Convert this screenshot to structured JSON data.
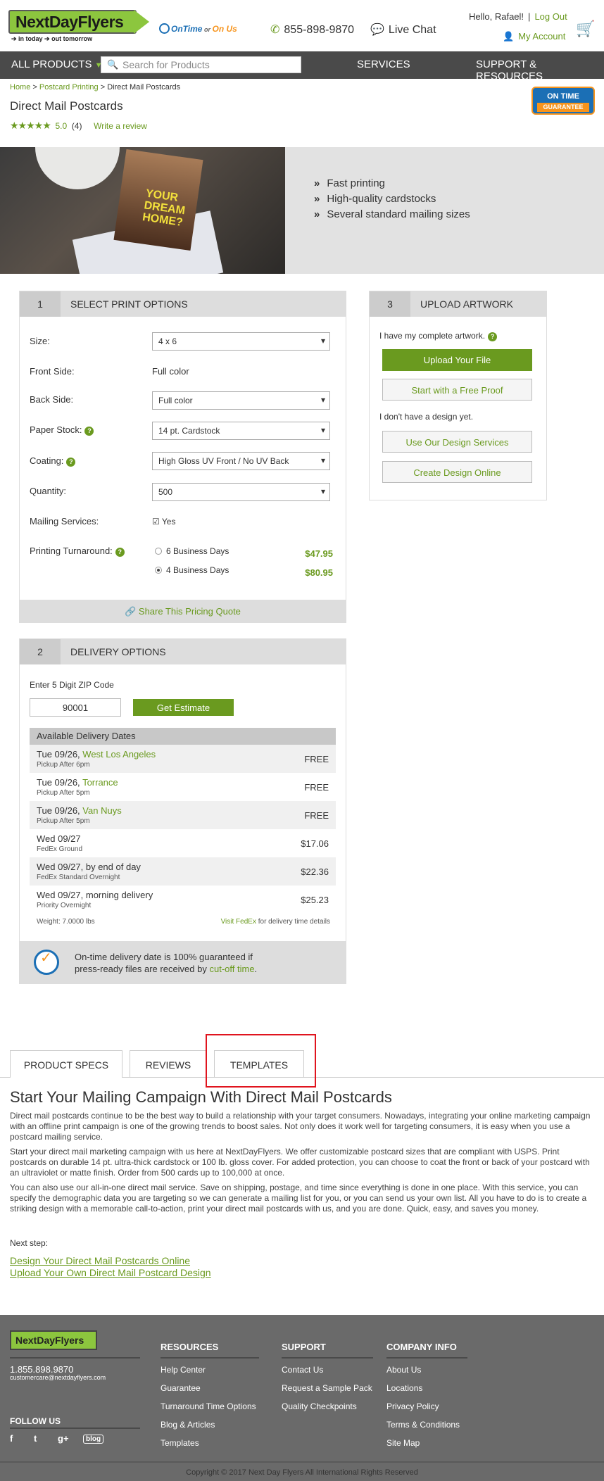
{
  "header": {
    "logo": "NextDayFlyers",
    "tagline": "➔ in today ➔ out tomorrow",
    "ontime": "OnTime",
    "ontime_or": " or ",
    "ontime_us": "On Us",
    "phone": "855-898-9870",
    "live_chat": "Live Chat",
    "greeting": "Hello, Rafael!",
    "logout": "Log Out",
    "my_account": "My Account"
  },
  "nav": {
    "all_products": "ALL PRODUCTS",
    "search_placeholder": "Search for Products",
    "services": "SERVICES",
    "support": "SUPPORT & RESOURCES"
  },
  "breadcrumb": {
    "home": "Home",
    "sep": " > ",
    "printing": "Postcard Printing",
    "current": "Direct Mail Postcards"
  },
  "product": {
    "title": "Direct Mail Postcards",
    "stars": "★★★★★",
    "rating": "5.0",
    "count": "(4)",
    "write_review": "Write a review",
    "badge_top": "ON TIME",
    "badge_bottom": "GUARANTEE",
    "hero_card_text": "YOUR DREAM HOME?",
    "bullets": [
      "Fast printing",
      "High-quality cardstocks",
      "Several standard mailing sizes"
    ]
  },
  "print_options": {
    "num": "1",
    "title": "SELECT PRINT OPTIONS",
    "size_label": "Size:",
    "size": "4 x 6",
    "front_label": "Front Side:",
    "front": "Full color",
    "back_label": "Back Side:",
    "back": "Full color",
    "paper_label": "Paper Stock:",
    "paper": "14 pt. Cardstock",
    "coating_label": "Coating:",
    "coating": "High Gloss UV Front / No UV Back",
    "qty_label": "Quantity:",
    "qty": "500",
    "mailing_label": "Mailing Services:",
    "mailing": "Yes",
    "turn_label": "Printing Turnaround:",
    "turn1": "6 Business Days",
    "turn1_price": "$47.95",
    "turn2": "4 Business Days",
    "turn2_price": "$80.95",
    "share": "Share This Pricing Quote"
  },
  "upload": {
    "num": "3",
    "title": "UPLOAD ARTWORK",
    "have_artwork": "I have my complete artwork.",
    "upload_btn": "Upload Your File",
    "proof_btn": "Start with a Free Proof",
    "no_design": "I don't have a design yet.",
    "design_services": "Use Our Design Services",
    "design_online": "Create Design Online"
  },
  "delivery": {
    "num": "2",
    "title": "DELIVERY OPTIONS",
    "zip_label": "Enter 5 Digit ZIP Code",
    "zip": "90001",
    "estimate": "Get Estimate",
    "table_header": "Available Delivery Dates",
    "rows": [
      {
        "date": "Tue 09/26, ",
        "place": "West Los Angeles",
        "sub": "Pickup After 6pm",
        "price": "FREE"
      },
      {
        "date": "Tue 09/26, ",
        "place": "Torrance",
        "sub": "Pickup After 5pm",
        "price": "FREE"
      },
      {
        "date": "Tue 09/26, ",
        "place": "Van Nuys",
        "sub": "Pickup After 5pm",
        "price": "FREE"
      },
      {
        "date": "Wed 09/27",
        "place": "",
        "sub": "FedEx Ground",
        "price": "$17.06"
      },
      {
        "date": "Wed 09/27, by end of day",
        "place": "",
        "sub": "FedEx Standard Overnight",
        "price": "$22.36"
      },
      {
        "date": "Wed 09/27, morning delivery",
        "place": "",
        "sub": "Priority Overnight",
        "price": "$25.23"
      }
    ],
    "weight": "Weight: 7.0000 lbs",
    "visit_fedex": "Visit FedEx",
    "visit_rest": " for delivery time details",
    "guarantee_1": "On-time delivery date is 100% guaranteed if",
    "guarantee_2": "press-ready files are received by ",
    "cutoff": "cut-off time",
    "dot": "."
  },
  "tabs": [
    "PRODUCT SPECS",
    "REVIEWS",
    "TEMPLATES"
  ],
  "content": {
    "heading": "Start Your Mailing Campaign With Direct Mail Postcards",
    "p1": "Direct mail postcards continue to be the best way to build a relationship with your target consumers. Nowadays, integrating your online marketing campaign with an offline print campaign is one of the growing trends to boost sales. Not only does it work well for targeting consumers, it is easy when you use a postcard mailing service.",
    "p2": "Start your direct mail marketing campaign with us here at NextDayFlyers. We offer customizable postcard sizes that are compliant with USPS. Print postcards on durable 14 pt. ultra-thick cardstock or 100 lb. gloss cover. For added protection, you can choose to coat the front or back of your postcard with an ultraviolet or matte finish. Order from 500 cards up to 100,000 at once.",
    "p3": "You can also use our all-in-one direct mail service. Save on shipping, postage, and time since everything is done in one place. With this service, you can specify the demographic data you are targeting so we can generate a mailing list for you, or you can send us your own list. All you have to do is to create a striking design with a memorable call-to-action, print your direct mail postcards with us, and you are done. Quick, easy, and saves you money.",
    "next_step": "Next step:",
    "link1": "Design Your Direct Mail Postcards Online",
    "link2": "Upload Your Own Direct Mail Postcard Design"
  },
  "footer": {
    "logo": "NextDayFlyers",
    "phone": "1.855.898.9870",
    "email": "customercare@nextdayflyers.com",
    "follow": "FOLLOW US",
    "social": [
      "f",
      "t",
      "g+",
      "blog"
    ],
    "resources_h": "RESOURCES",
    "resources": [
      "Help Center",
      "Guarantee",
      "Turnaround Time Options",
      "Blog & Articles",
      "Templates"
    ],
    "support_h": "SUPPORT",
    "support": [
      "Contact Us",
      "Request a Sample Pack",
      "Quality Checkpoints"
    ],
    "company_h": "COMPANY INFO",
    "company": [
      "About Us",
      "Locations",
      "Privacy Policy",
      "Terms & Conditions",
      "Site Map"
    ],
    "copyright": "Copyright © 2017 Next Day Flyers All International Rights Reserved"
  }
}
